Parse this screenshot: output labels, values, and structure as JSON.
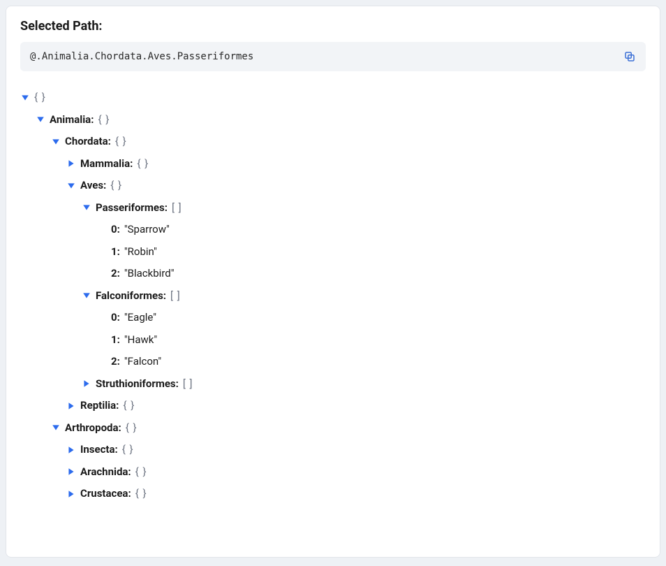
{
  "header": {
    "title": "Selected Path:",
    "path": "@.Animalia.Chordata.Aves.Passeriformes"
  },
  "braces": {
    "object": "{ }",
    "array": "[ ]"
  },
  "tree": {
    "root": {
      "animalia": {
        "label": "Animalia",
        "chordata": {
          "label": "Chordata",
          "mammalia": {
            "label": "Mammalia"
          },
          "aves": {
            "label": "Aves",
            "passeriformes": {
              "label": "Passeriformes",
              "items": [
                {
                  "idx": "0",
                  "val": "\"Sparrow\""
                },
                {
                  "idx": "1",
                  "val": "\"Robin\""
                },
                {
                  "idx": "2",
                  "val": "\"Blackbird\""
                }
              ]
            },
            "falconiformes": {
              "label": "Falconiformes",
              "items": [
                {
                  "idx": "0",
                  "val": "\"Eagle\""
                },
                {
                  "idx": "1",
                  "val": "\"Hawk\""
                },
                {
                  "idx": "2",
                  "val": "\"Falcon\""
                }
              ]
            },
            "struthioniformes": {
              "label": "Struthioniformes"
            }
          },
          "reptilia": {
            "label": "Reptilia"
          }
        },
        "arthropoda": {
          "label": "Arthropoda",
          "insecta": {
            "label": "Insecta"
          },
          "arachnida": {
            "label": "Arachnida"
          },
          "crustacea": {
            "label": "Crustacea"
          }
        }
      }
    }
  }
}
